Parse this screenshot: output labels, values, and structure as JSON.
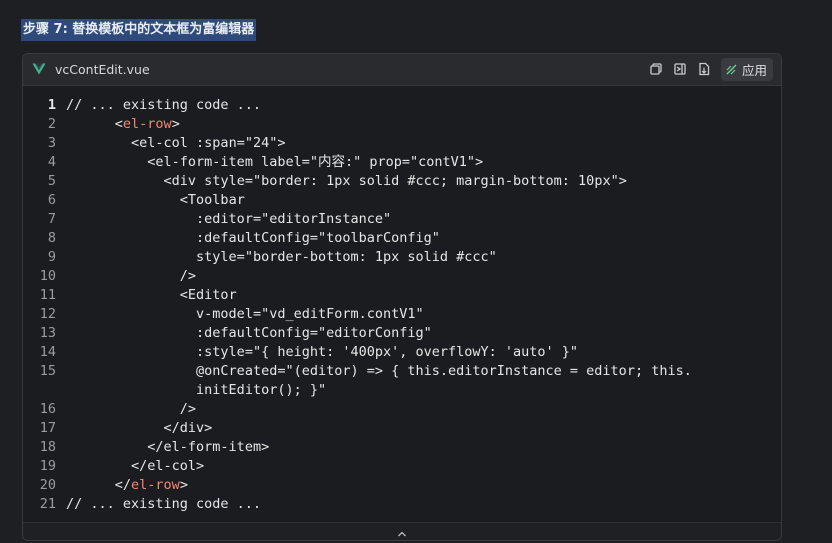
{
  "step": {
    "title": "步骤 7: 替换模板中的文本框为富编辑器"
  },
  "code_block": {
    "filename": "vcContEdit.vue",
    "apply_label": "应用",
    "lines": [
      {
        "num": "1",
        "indent": "",
        "pre": "// ... existing code ...",
        "tag": "",
        "post": ""
      },
      {
        "num": "2",
        "indent": "      ",
        "pre": "<",
        "tag": "el-row",
        "post": ">"
      },
      {
        "num": "3",
        "indent": "        ",
        "pre": "<el-col :span=\"24\">",
        "tag": "",
        "post": ""
      },
      {
        "num": "4",
        "indent": "          ",
        "pre": "<el-form-item label=\"内容:\" prop=\"contV1\">",
        "tag": "",
        "post": ""
      },
      {
        "num": "5",
        "indent": "            ",
        "pre": "<div style=\"border: 1px solid #ccc; margin-bottom: 10px\">",
        "tag": "",
        "post": ""
      },
      {
        "num": "6",
        "indent": "              ",
        "pre": "<Toolbar",
        "tag": "",
        "post": ""
      },
      {
        "num": "7",
        "indent": "                ",
        "pre": ":editor=\"editorInstance\"",
        "tag": "",
        "post": ""
      },
      {
        "num": "8",
        "indent": "                ",
        "pre": ":defaultConfig=\"toolbarConfig\"",
        "tag": "",
        "post": ""
      },
      {
        "num": "9",
        "indent": "                ",
        "pre": "style=\"border-bottom: 1px solid #ccc\"",
        "tag": "",
        "post": ""
      },
      {
        "num": "10",
        "indent": "              ",
        "pre": "/>",
        "tag": "",
        "post": ""
      },
      {
        "num": "11",
        "indent": "              ",
        "pre": "<Editor",
        "tag": "",
        "post": ""
      },
      {
        "num": "12",
        "indent": "                ",
        "pre": "v-model=\"vd_editForm.contV1\"",
        "tag": "",
        "post": ""
      },
      {
        "num": "13",
        "indent": "                ",
        "pre": ":defaultConfig=\"editorConfig\"",
        "tag": "",
        "post": ""
      },
      {
        "num": "14",
        "indent": "                ",
        "pre": ":style=\"{ height: '400px', overflowY: 'auto' }\"",
        "tag": "",
        "post": ""
      },
      {
        "num": "15",
        "indent": "                ",
        "pre": "@onCreated=\"(editor) => { this.editorInstance = editor; this.",
        "tag": "",
        "post": ""
      },
      {
        "num": "",
        "indent": "                ",
        "pre": "initEditor(); }\"",
        "tag": "",
        "post": ""
      },
      {
        "num": "16",
        "indent": "              ",
        "pre": "/>",
        "tag": "",
        "post": ""
      },
      {
        "num": "17",
        "indent": "            ",
        "pre": "</div>",
        "tag": "",
        "post": ""
      },
      {
        "num": "18",
        "indent": "          ",
        "pre": "</el-form-item>",
        "tag": "",
        "post": ""
      },
      {
        "num": "19",
        "indent": "        ",
        "pre": "</el-col>",
        "tag": "",
        "post": ""
      },
      {
        "num": "20",
        "indent": "      ",
        "pre": "</",
        "tag": "el-row",
        "post": ">"
      },
      {
        "num": "21",
        "indent": "",
        "pre": "// ... existing code ...",
        "tag": "",
        "post": ""
      }
    ]
  },
  "icons": {
    "file_type": "vue-icon",
    "copy": "copy-icon",
    "insert": "insert-icon",
    "new_file": "new-file-icon",
    "apply": "apply-icon",
    "collapse": "chevron-up-icon"
  },
  "colors": {
    "vue_green": "#41b883",
    "tag_red": "#f48771",
    "heading_highlight": "#2f4a7a"
  }
}
